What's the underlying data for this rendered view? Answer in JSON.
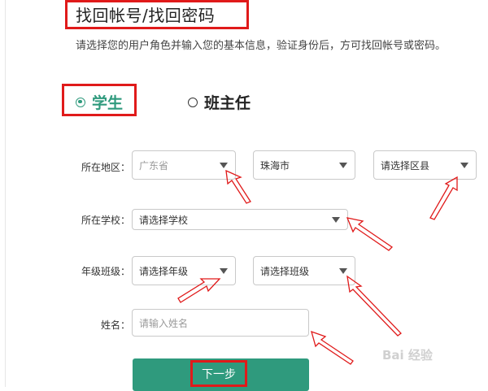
{
  "header": {
    "title": "找回帐号/找回密码",
    "subtitle": "请选择您的用户角色并输入您的基本信息，验证身份后，方可找回帐号或密码。"
  },
  "roles": {
    "student": "学生",
    "teacher": "班主任",
    "selected": "学生"
  },
  "form": {
    "region_label": "所在地区：",
    "province": "广东省",
    "city": "珠海市",
    "district": "请选择区县",
    "school_label": "所在学校：",
    "school": "请选择学校",
    "class_label": "年级班级：",
    "grade": "请选择年级",
    "class": "请选择班级",
    "name_label": "姓名：",
    "name_placeholder": "请输入姓名"
  },
  "actions": {
    "next": "下一步"
  },
  "watermark": "Bai 经验",
  "colors": {
    "accent": "#2f9a7d",
    "highlight": "#e01a1a"
  },
  "icons": {
    "select_caret": "chevron-down-icon",
    "radio": "radio-icon"
  }
}
